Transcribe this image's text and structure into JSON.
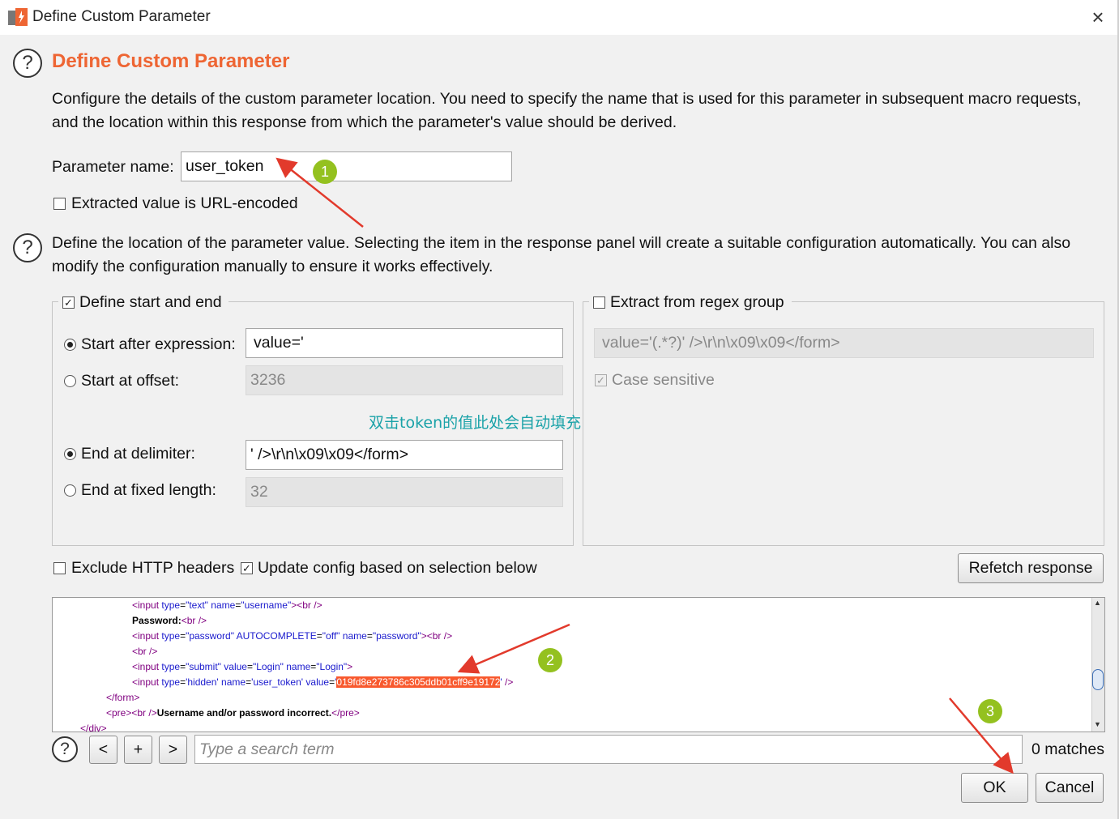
{
  "window": {
    "title": "Define Custom Parameter",
    "close_glyph": "×"
  },
  "header": {
    "help_glyph": "?",
    "title": "Define Custom Parameter",
    "description_line1": "Configure the details of the custom parameter location. You need to specify the name that is used for this parameter in subsequent macro requests,",
    "description_line2": "and the location within this response from which the parameter's value should be derived."
  },
  "param": {
    "label": "Parameter name:",
    "value": "user_token",
    "url_encoded_label": "Extracted value is URL-encoded",
    "url_encoded_checked": false
  },
  "location": {
    "help_glyph": "?",
    "description_line1": "Define the location of the parameter value. Selecting the item in the response panel will create a suitable configuration automatically. You can also",
    "description_line2": "modify the configuration manually to ensure it works effectively."
  },
  "start_end": {
    "legend": "Define start and end",
    "checked": true,
    "start_after_label": "Start after expression:",
    "start_after_value": "value='",
    "start_after_selected": true,
    "start_offset_label": "Start at offset:",
    "start_offset_value": "3236",
    "end_delim_label": "End at delimiter:",
    "end_delim_value": "' />\\r\\n\\x09\\x09</form>",
    "end_delim_selected": true,
    "end_fixed_label": "End at fixed length:",
    "end_fixed_value": "32"
  },
  "regex": {
    "legend": "Extract from regex group",
    "checked": false,
    "value": "value='(.*?)' />\\r\\n\\x09\\x09</form>",
    "case_label": "Case sensitive",
    "case_checked": true
  },
  "annotation_note": "双击token的值此处会自动填充",
  "options": {
    "exclude_headers_label": "Exclude HTTP headers",
    "exclude_headers_checked": false,
    "update_config_label": "Update config based on selection below",
    "update_config_checked": true,
    "refetch_label": "Refetch response"
  },
  "response_lines": [
    {
      "parts": [
        [
          "tag",
          "<input "
        ],
        [
          "attr",
          "type"
        ],
        [
          "",
          "="
        ],
        [
          "val",
          "\"text\""
        ],
        [
          "",
          " "
        ],
        [
          "attr",
          "name"
        ],
        [
          "",
          "="
        ],
        [
          "val",
          "\"username\""
        ],
        [
          "tag",
          "><br />"
        ]
      ]
    },
    {
      "parts": [
        [
          "bold",
          "Password:"
        ],
        [
          "tag",
          "<br />"
        ]
      ]
    },
    {
      "parts": [
        [
          "tag",
          "<input "
        ],
        [
          "attr",
          "type"
        ],
        [
          "",
          "="
        ],
        [
          "val",
          "\"password\""
        ],
        [
          "",
          " "
        ],
        [
          "attr",
          "AUTOCOMPLETE"
        ],
        [
          "",
          "="
        ],
        [
          "val",
          "\"off\""
        ],
        [
          "",
          " "
        ],
        [
          "attr",
          "name"
        ],
        [
          "",
          "="
        ],
        [
          "val",
          "\"password\""
        ],
        [
          "tag",
          "><br />"
        ]
      ]
    },
    {
      "parts": [
        [
          "tag",
          "<br />"
        ]
      ]
    },
    {
      "parts": [
        [
          "tag",
          "<input "
        ],
        [
          "attr",
          "type"
        ],
        [
          "",
          "="
        ],
        [
          "val",
          "\"submit\""
        ],
        [
          "",
          " "
        ],
        [
          "attr",
          "value"
        ],
        [
          "",
          "="
        ],
        [
          "val",
          "\"Login\""
        ],
        [
          "",
          " "
        ],
        [
          "attr",
          "name"
        ],
        [
          "",
          "="
        ],
        [
          "val",
          "\"Login\""
        ],
        [
          "tag",
          ">"
        ]
      ]
    },
    {
      "parts": [
        [
          "tag",
          "<input "
        ],
        [
          "attr",
          "type"
        ],
        [
          "",
          "="
        ],
        [
          "val",
          "'hidden'"
        ],
        [
          "",
          " "
        ],
        [
          "attr",
          "name"
        ],
        [
          "",
          "="
        ],
        [
          "val",
          "'user_token'"
        ],
        [
          "",
          " "
        ],
        [
          "attr",
          "value"
        ],
        [
          "",
          "="
        ],
        [
          "val",
          "'"
        ],
        [
          "hl",
          "019fd8e273786c305ddb01cff9e19172"
        ],
        [
          "val",
          "'"
        ],
        [
          "tag",
          " />"
        ]
      ]
    },
    {
      "parts": [
        [
          "tag",
          "</form>"
        ]
      ]
    },
    {
      "parts": [
        [
          "tag",
          "<pre><br />"
        ],
        [
          "bold",
          "Username and/or password incorrect."
        ],
        [
          "tag",
          "</pre>"
        ]
      ]
    },
    {
      "parts": [
        [
          "tag",
          "</div>"
        ]
      ]
    }
  ],
  "search": {
    "help_glyph": "?",
    "prev_label": "<",
    "add_label": "+",
    "next_label": ">",
    "placeholder": "Type a search term",
    "matches": "0 matches"
  },
  "footer": {
    "ok_label": "OK",
    "cancel_label": "Cancel"
  },
  "annotations": {
    "marker1": "1",
    "marker2": "2",
    "marker3": "3",
    "color": "#e23a2c",
    "marker_color": "#94c11f"
  }
}
